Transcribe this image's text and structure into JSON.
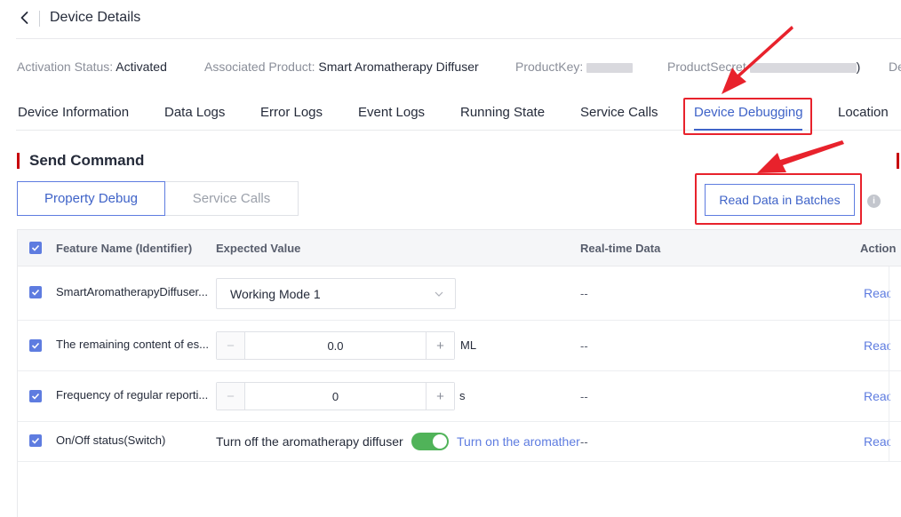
{
  "header": {
    "title": "Device Details"
  },
  "info": {
    "activation_status_label": "Activation Status:",
    "activation_status_value": "Activated",
    "product_label": "Associated Product:",
    "product_value": "Smart Aromatherapy Diffuser",
    "productkey_label": "ProductKey:",
    "productsecret_label": "ProductSecret",
    "productsecret_tail": ")",
    "truncated_label": "De"
  },
  "tabs": [
    {
      "label": "Device Information"
    },
    {
      "label": "Data Logs"
    },
    {
      "label": "Error Logs"
    },
    {
      "label": "Event Logs"
    },
    {
      "label": "Running State"
    },
    {
      "label": "Service Calls"
    },
    {
      "label": "Device Debugging",
      "active": true
    },
    {
      "label": "Location"
    }
  ],
  "section": {
    "title": "Send Command"
  },
  "segments": {
    "property_debug": "Property Debug",
    "service_calls": "Service Calls"
  },
  "read_batch_label": "Read Data in Batches",
  "info_icon_glyph": "i",
  "table": {
    "headers": {
      "feature_name": "Feature Name (Identifier)",
      "expected_value": "Expected Value",
      "realtime": "Real-time Data",
      "action": "Action"
    },
    "rows": [
      {
        "name": "SmartAromatherapyDiffuser...",
        "expected": "Working Mode 1",
        "realtime": "--",
        "action": "Read"
      },
      {
        "name": "The remaining content of es...",
        "value": "0.0",
        "unit": "ML",
        "realtime": "--",
        "action": "Read"
      },
      {
        "name": "Frequency of regular reporti...",
        "value": "0",
        "unit": "s",
        "realtime": "--",
        "action": "Read"
      },
      {
        "name": "On/Off status(Switch)",
        "off_label": "Turn off the aromatherapy diffuser",
        "on_label": "Turn on the aromather",
        "realtime": "--",
        "action": "Read"
      }
    ]
  },
  "colors": {
    "accent": "#5e7ce0",
    "annotation_red": "#e8222c",
    "switch_on": "#50b359",
    "section_bar": "#c7000b"
  }
}
